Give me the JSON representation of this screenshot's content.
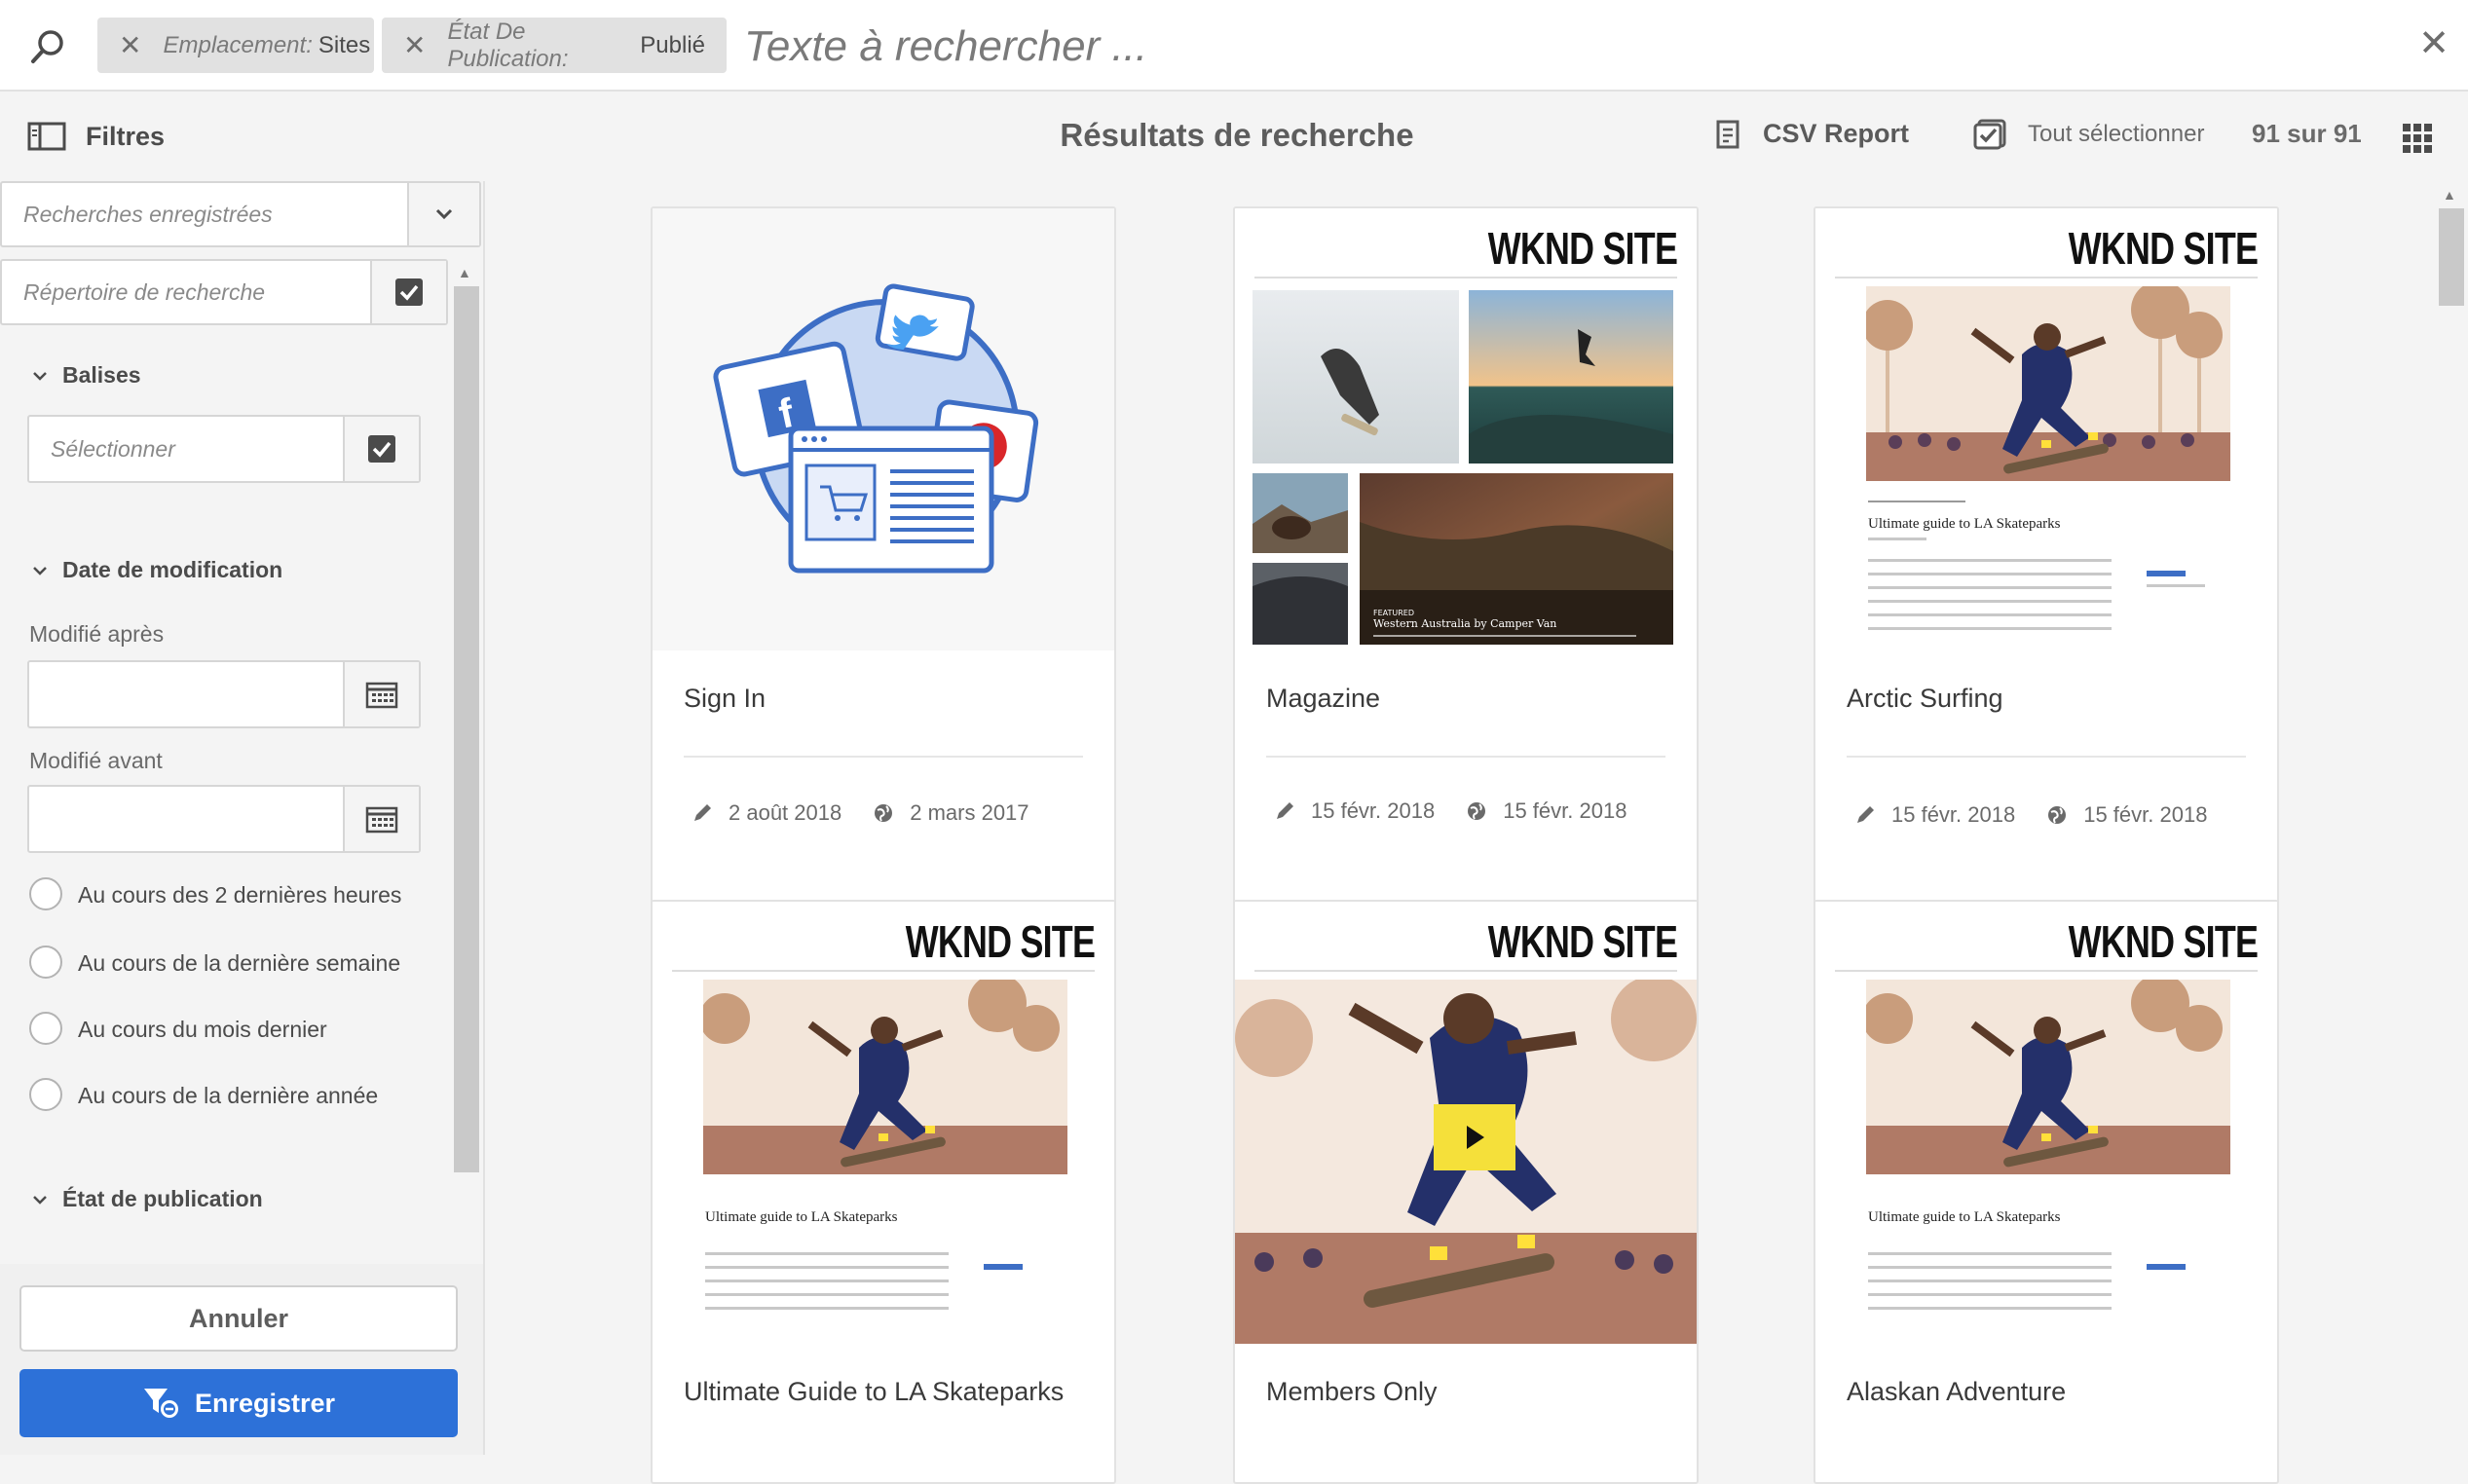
{
  "search": {
    "tags": [
      {
        "key": "Emplacement:",
        "value": "Sites"
      },
      {
        "key": "État De Publication:",
        "value": "Publié"
      }
    ],
    "placeholder": "Texte à rechercher ..."
  },
  "toolbar": {
    "filters_label": "Filtres",
    "title": "Résultats de recherche",
    "csv_label": "CSV Report",
    "select_all_label": "Tout sélectionner",
    "count": "91 sur 91"
  },
  "sidebar": {
    "saved_searches_placeholder": "Recherches enregistrées",
    "search_dir_placeholder": "Répertoire de recherche",
    "tags_section": "Balises",
    "tags_placeholder": "Sélectionner",
    "date_section": "Date de modification",
    "modified_after": "Modifié après",
    "modified_before": "Modifié avant",
    "radio_options": [
      "Au cours des 2 dernières heures",
      "Au cours de la dernière semaine",
      "Au cours du mois dernier",
      "Au cours de la dernière année"
    ],
    "publish_section": "État de publication",
    "cancel_label": "Annuler",
    "save_label": "Enregistrer"
  },
  "cards": [
    {
      "title": "Sign In",
      "modified": "2 août 2018",
      "published": "2 mars 2017"
    },
    {
      "title": "Magazine",
      "modified": "15 févr. 2018",
      "published": "15 févr. 2018",
      "brand": "WKND SITE",
      "feature_tag": "FEATURED",
      "feature_title": "Western Australia by Camper Van"
    },
    {
      "title": "Arctic Surfing",
      "modified": "15 févr. 2018",
      "published": "15 févr. 2018",
      "brand": "WKND SITE",
      "article": "Ultimate guide to LA Skateparks"
    },
    {
      "title": "Ultimate Guide to LA Skateparks",
      "brand": "WKND SITE",
      "article": "Ultimate guide to LA Skateparks"
    },
    {
      "title": "Members Only",
      "brand": "WKND SITE"
    },
    {
      "title": "Alaskan Adventure",
      "brand": "WKND SITE",
      "article": "Ultimate guide to LA Skateparks"
    }
  ],
  "colors": {
    "accent": "#2d71d8",
    "tag_bg": "#e1e1e1",
    "background": "#f4f4f4"
  }
}
